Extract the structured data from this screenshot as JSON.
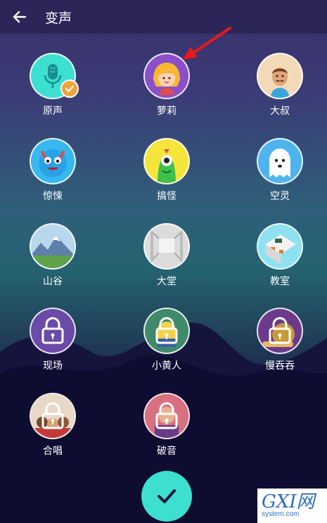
{
  "header": {
    "title": "变声"
  },
  "voices": [
    {
      "label": "原声",
      "state": "selected",
      "icon": "microphone-icon",
      "bg": "#3de0d0"
    },
    {
      "label": "萝莉",
      "state": "unlocked",
      "icon": "girl-avatar",
      "bg": "#8a4fc9"
    },
    {
      "label": "大叔",
      "state": "unlocked",
      "icon": "man-avatar",
      "bg": "#f2d9b8"
    },
    {
      "label": "惊悚",
      "state": "unlocked",
      "icon": "blue-monster",
      "bg": "#37b8f0"
    },
    {
      "label": "搞怪",
      "state": "unlocked",
      "icon": "green-monster",
      "bg": "#f5e53a"
    },
    {
      "label": "空灵",
      "state": "unlocked",
      "icon": "ghost",
      "bg": "#4fb4ee"
    },
    {
      "label": "山谷",
      "state": "unlocked",
      "icon": "mountain-landscape",
      "bg": "#9ec5de"
    },
    {
      "label": "大堂",
      "state": "unlocked",
      "icon": "hall-interior",
      "bg": "#cfcfcf"
    },
    {
      "label": "教室",
      "state": "unlocked",
      "icon": "classroom",
      "bg": "#7fd9ec"
    },
    {
      "label": "现场",
      "state": "locked",
      "icon": "lock-icon",
      "bg": "#6b4aa8"
    },
    {
      "label": "小黄人",
      "state": "locked",
      "icon": "lock-icon",
      "bg": "#3f8a6a"
    },
    {
      "label": "慢吞吞",
      "state": "locked",
      "icon": "lock-icon",
      "bg": "#6b3a8a"
    },
    {
      "label": "合唱",
      "state": "locked",
      "icon": "lock-icon",
      "bg": "#b88a6a"
    },
    {
      "label": "破音",
      "state": "locked",
      "icon": "lock-icon",
      "bg": "#c45a6a"
    }
  ],
  "watermark": {
    "logo": "GXI网",
    "sub": "system.com"
  },
  "colors": {
    "accent": "#3de0d0",
    "badge": "#f2a23a",
    "annotation": "#e8191c"
  }
}
